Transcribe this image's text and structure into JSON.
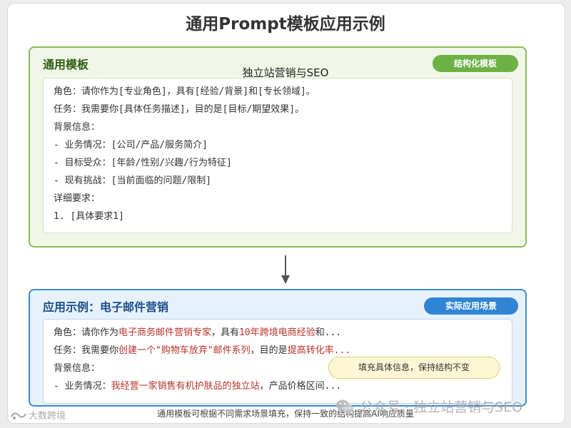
{
  "title": "通用Prompt模板应用示例",
  "overlay_text": "独立站营销与SEO",
  "template_panel": {
    "title": "通用模板",
    "badge": "结构化模板",
    "lines": [
      "角色：请你作为[专业角色]，具有[经验/背景]和[专长领域]。",
      "任务：我需要你[具体任务描述]，目的是[目标/期望效果]。",
      "背景信息：",
      "- 业务情况：[公司/产品/服务简介]",
      "- 目标受众：[年龄/性别/兴趣/行为特征]",
      "- 现有挑战：[当前面临的问题/限制]",
      "详细要求：",
      "1. [具体要求1]"
    ]
  },
  "example_panel": {
    "title": "应用示例：电子邮件营销",
    "badge": "实际应用场景",
    "line1": {
      "pre": "角色：请你作为",
      "hl1": "电子商务邮件营销专家",
      "mid": "，具有",
      "hl2": "10年跨境电商经验",
      "post": "和..."
    },
    "line2": {
      "pre": "任务：我需要你",
      "hl1": "创建一个\"购物车放弃\"邮件系列",
      "mid": "，目的是",
      "hl2": "提高转化率..."
    },
    "line3": "背景信息：",
    "line4": {
      "pre": "- 业务情况：",
      "hl1": "我经营一家销售有机护肤品的独立站",
      "post": "，产品价格区间..."
    }
  },
  "callout": "填充具体信息，保持结构不变",
  "footer": "通用模板可根据不同需求场景填充，保持一致的结构提高AI响应质量",
  "watermarks": {
    "left": "大数跨境",
    "right": "公众号 · 独立站营销与SEO"
  },
  "colors": {
    "template_border": "#8bbd58",
    "template_badge": "#6cb144",
    "example_border": "#3e8ad0",
    "example_badge": "#2f84d4",
    "highlight": "#b8322a",
    "callout_bg": "#fdf7d6"
  }
}
